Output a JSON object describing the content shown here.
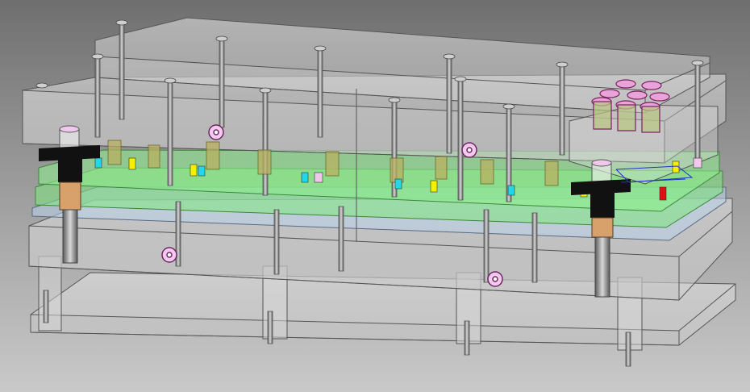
{
  "scene": {
    "background": {
      "top": "#6f6f6f",
      "bottom": "#c9c9c9"
    },
    "colors": {
      "outline": "#4a4a4a",
      "glass": "#dcdcdc",
      "stripper_plate": "#7ee87e",
      "die_plate": "#b9d2ea",
      "guide_bush": "#111111",
      "bronze_sleeve": "#d8a06a",
      "spring_coil": "#b8b060",
      "purple_spring": "#c84ea8",
      "screw_head": "#cfcfcf",
      "pink_part": "#f0c8ec",
      "cyan_part": "#22d8e8",
      "yellow_part": "#f4f000",
      "red_part": "#e01010",
      "blue_line": "#2030c8"
    },
    "icons": [
      "guide-post-icon",
      "guide-bush-icon",
      "socket-screw-icon",
      "coil-spring-icon",
      "dowel-pin-icon",
      "lifting-eye-icon"
    ]
  }
}
